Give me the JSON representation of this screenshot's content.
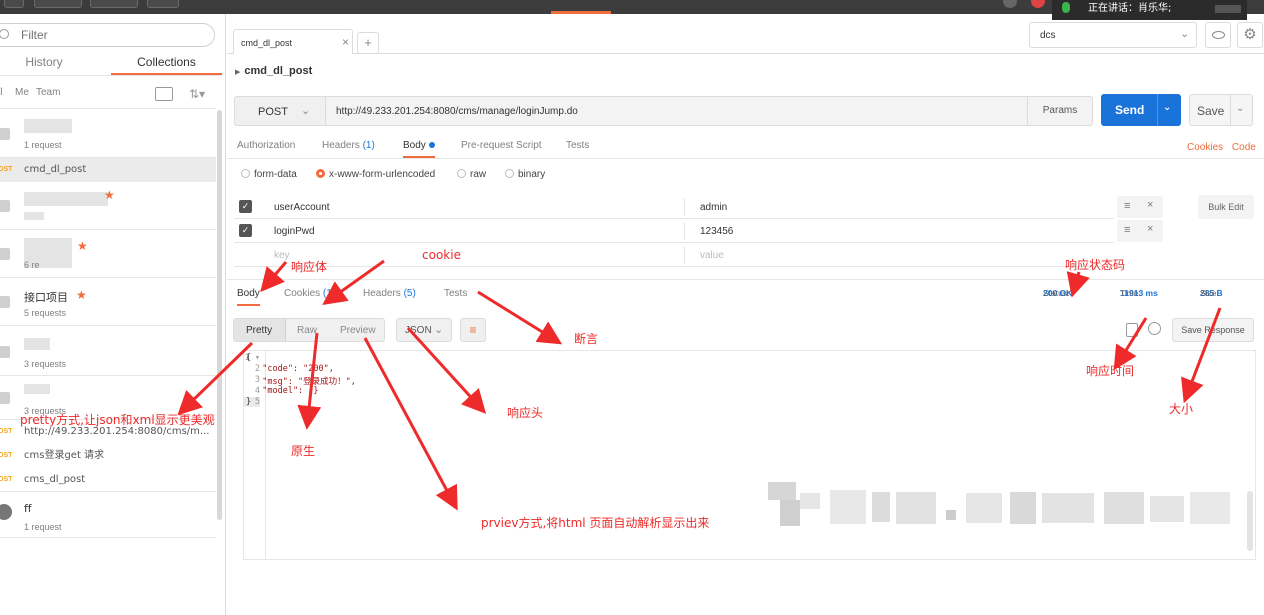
{
  "topbar": {
    "speaking_text": "正在讲话：肖乐华;"
  },
  "sidebar": {
    "filter_placeholder": "Filter",
    "tabs": [
      "History",
      "Collections"
    ],
    "scope": {
      "all": "ll",
      "me": "Me",
      "team": "Team"
    },
    "collections": [
      {
        "name": "",
        "sub": "1 request"
      },
      {
        "name": "",
        "sub": ""
      },
      {
        "name": "",
        "sub": "6 re"
      },
      {
        "name": "接口项目",
        "sub": "5 requests"
      },
      {
        "name": "",
        "sub": "3 requests"
      },
      {
        "name": "",
        "sub": "3 requests"
      },
      {
        "name": "ff",
        "sub": "1 request"
      }
    ],
    "requests": [
      {
        "method": "OST",
        "name": "cmd_dl_post"
      },
      {
        "method": "OST",
        "name": "http://49.233.201.254:8080/cms/m..."
      },
      {
        "method": "OST",
        "name": "cms登录get 请求"
      },
      {
        "method": "OST",
        "name": "cms_dl_post"
      }
    ]
  },
  "tabs": {
    "active": "cmd_dl_post",
    "add": "+"
  },
  "environment": {
    "selected": "dcs"
  },
  "request": {
    "name": "cmd_dl_post",
    "method": "POST",
    "url": "http://49.233.201.254:8080/cms/manage/loginJump.do",
    "params_label": "Params",
    "send_label": "Send",
    "save_label": "Save",
    "subtabs": [
      "Authorization",
      "Headers",
      "Body",
      "Pre-request Script",
      "Tests"
    ],
    "headers_count": "(1)",
    "cookies_link": "Cookies",
    "code_link": "Code",
    "body_types": [
      "form-data",
      "x-www-form-urlencoded",
      "raw",
      "binary"
    ],
    "body_type_selected": "x-www-form-urlencoded",
    "params": [
      {
        "key": "userAccount",
        "value": "admin",
        "checked": true
      },
      {
        "key": "loginPwd",
        "value": "123456",
        "checked": true
      }
    ],
    "placeholder_key": "key",
    "placeholder_value": "value",
    "bulk_edit": "Bulk Edit"
  },
  "response": {
    "tabs": [
      "Body",
      "Cookies",
      "Headers",
      "Tests"
    ],
    "cookies_count": "(1)",
    "headers_count": "(5)",
    "status_label": "Status:",
    "status_value": "200 OK",
    "time_label": "Time:",
    "time_value": "11913 ms",
    "size_label": "Size:",
    "size_value": "285 B",
    "views": [
      "Pretty",
      "Raw",
      "Preview"
    ],
    "format": "JSON",
    "save_response": "Save Response",
    "code_lines": [
      "{",
      "  \"code\": \"200\",",
      "  \"msg\": \"登录成功！\",",
      "  \"model\": {}",
      "}"
    ]
  },
  "annotations": {
    "body": "响应体",
    "cookie": "cookie",
    "status": "响应状态码",
    "assert": "断言",
    "time": "响应时间",
    "headers": "响应头",
    "size": "大小",
    "pretty": "pretty方式,让json和xml显示更美观",
    "raw": "原生",
    "preview": "prviev方式,将html 页面自动解析显示出来"
  },
  "colors": {
    "accent": "#f26b3a",
    "primary": "#1a73d9",
    "annotation": "#ee2a2a"
  }
}
